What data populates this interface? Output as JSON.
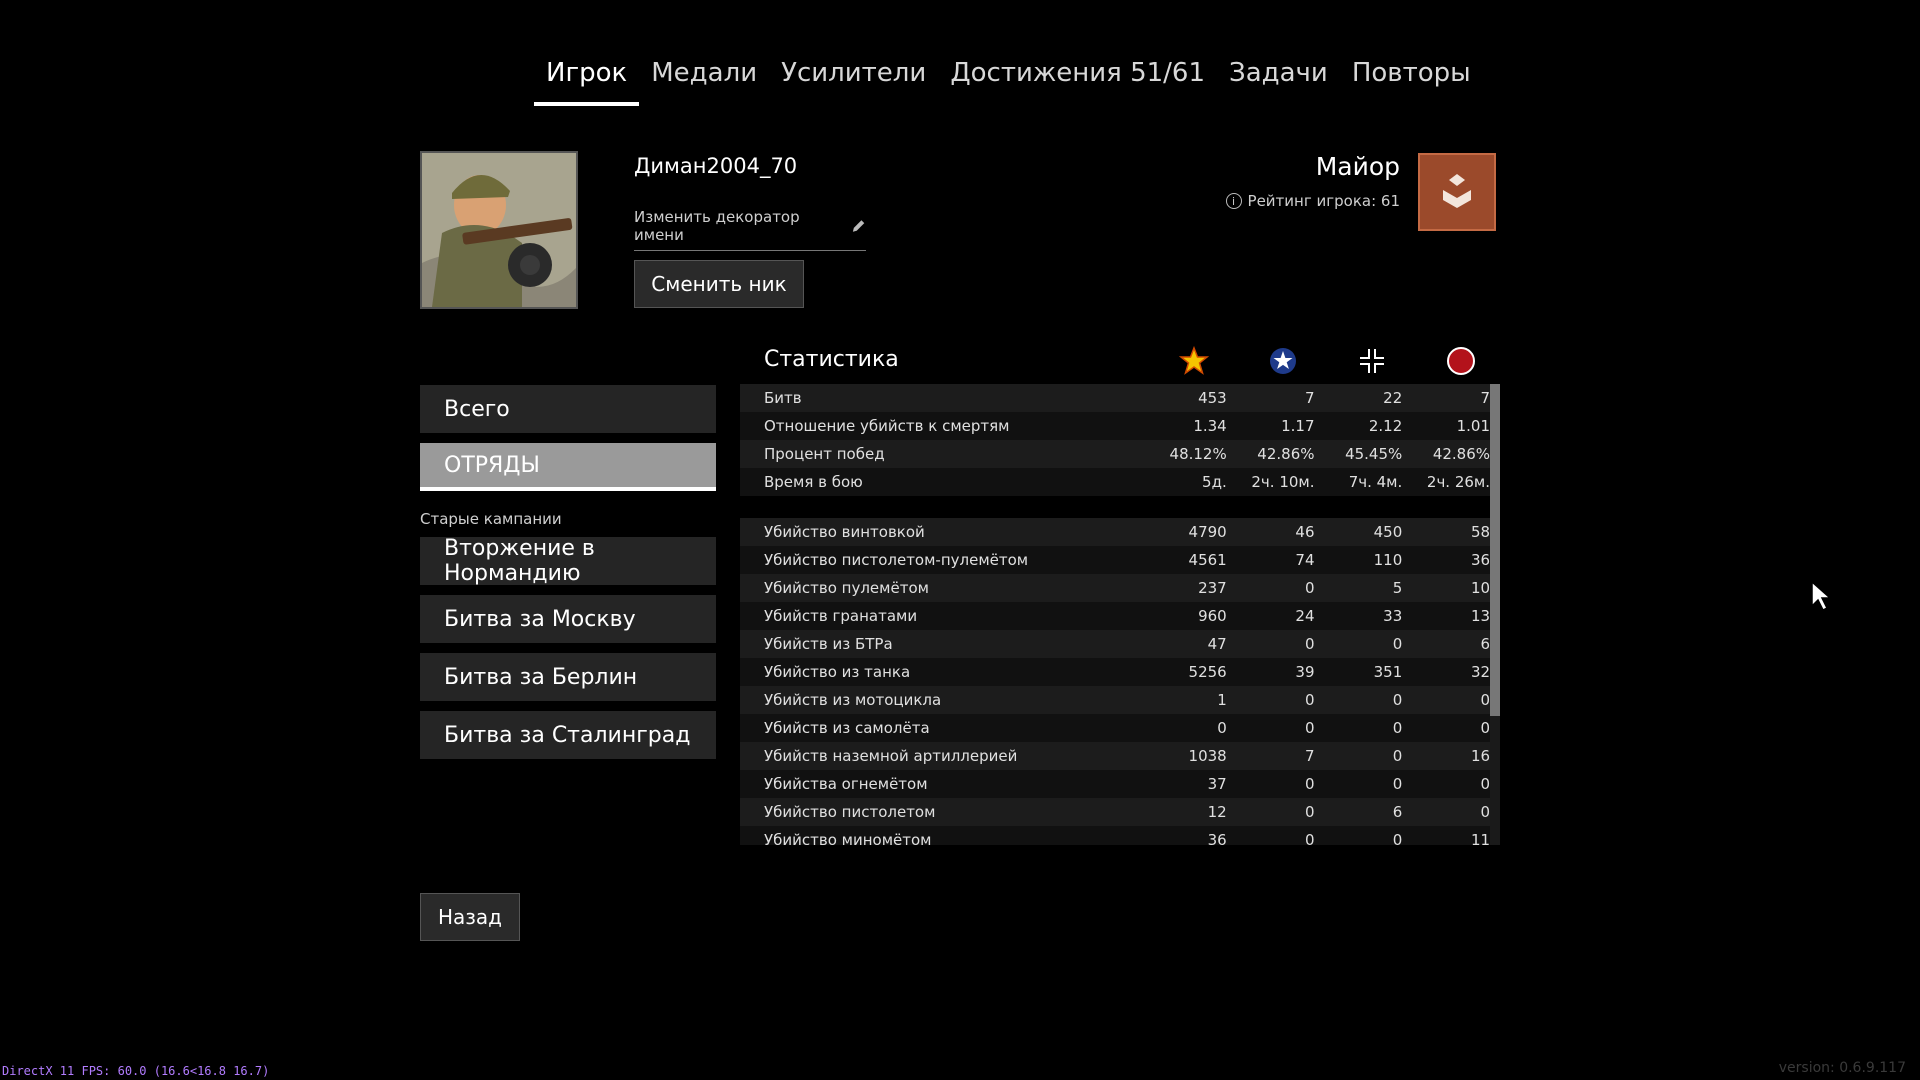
{
  "tabs": [
    {
      "label": "Игрок"
    },
    {
      "label": "Медали"
    },
    {
      "label": "Усилители"
    },
    {
      "label": "Достижения 51/61"
    },
    {
      "label": "Задачи"
    },
    {
      "label": "Повторы"
    }
  ],
  "player": {
    "name": "Диман2004_70",
    "decorator_link": "Изменить декоратор имени",
    "change_nick_label": "Сменить ник",
    "rank": "Майор",
    "rating": "Рейтинг игрока: 61"
  },
  "menu": {
    "items": [
      {
        "label": "Всего"
      },
      {
        "label": "ОТРЯДЫ"
      }
    ],
    "old_campaigns_label": "Старые кампании",
    "campaigns": [
      {
        "label": "Вторжение в Нормандию"
      },
      {
        "label": "Битва за Москву"
      },
      {
        "label": "Битва за Берлин"
      },
      {
        "label": "Битва за Сталинград"
      }
    ]
  },
  "stats": {
    "title": "Статистика",
    "columns": [
      "soviet-star-icon",
      "allied-star-icon",
      "german-cross-icon",
      "japan-sun-icon"
    ],
    "rows": [
      {
        "label": "Битв",
        "values": [
          "453",
          "7",
          "22",
          "7"
        ]
      },
      {
        "label": "Отношение убийств к смертям",
        "values": [
          "1.34",
          "1.17",
          "2.12",
          "1.01"
        ]
      },
      {
        "label": "Процент побед",
        "values": [
          "48.12%",
          "42.86%",
          "45.45%",
          "42.86%"
        ]
      },
      {
        "label": "Время в бою",
        "values": [
          "5д.",
          "2ч. 10м.",
          "7ч. 4м.",
          "2ч. 26м."
        ]
      },
      {
        "label": "Убийство винтовкой",
        "values": [
          "4790",
          "46",
          "450",
          "58"
        ]
      },
      {
        "label": "Убийство пистолетом-пулемётом",
        "values": [
          "4561",
          "74",
          "110",
          "36"
        ]
      },
      {
        "label": "Убийство пулемётом",
        "values": [
          "237",
          "0",
          "5",
          "10"
        ]
      },
      {
        "label": "Убийств гранатами",
        "values": [
          "960",
          "24",
          "33",
          "13"
        ]
      },
      {
        "label": "Убийств из БТРа",
        "values": [
          "47",
          "0",
          "0",
          "6"
        ]
      },
      {
        "label": "Убийство из танка",
        "values": [
          "5256",
          "39",
          "351",
          "32"
        ]
      },
      {
        "label": "Убийств из мотоцикла",
        "values": [
          "1",
          "0",
          "0",
          "0"
        ]
      },
      {
        "label": "Убийств из самолёта",
        "values": [
          "0",
          "0",
          "0",
          "0"
        ]
      },
      {
        "label": "Убийств наземной артиллерией",
        "values": [
          "1038",
          "7",
          "0",
          "16"
        ]
      },
      {
        "label": "Убийства огнемётом",
        "values": [
          "37",
          "0",
          "0",
          "0"
        ]
      },
      {
        "label": "Убийство пистолетом",
        "values": [
          "12",
          "0",
          "6",
          "0"
        ]
      },
      {
        "label": "Убийство миномётом",
        "values": [
          "36",
          "0",
          "0",
          "11"
        ]
      }
    ]
  },
  "back_label": "Назад",
  "fps_text": "DirectX 11 FPS: 60.0 (16.6<16.8 16.7)",
  "version_text": "version: 0.6.9.117",
  "colors": {
    "soviet": "#f5c400",
    "allied": "#1e3a8a",
    "japan": "#b3121b",
    "rank_badge": "#9b4a2b"
  }
}
